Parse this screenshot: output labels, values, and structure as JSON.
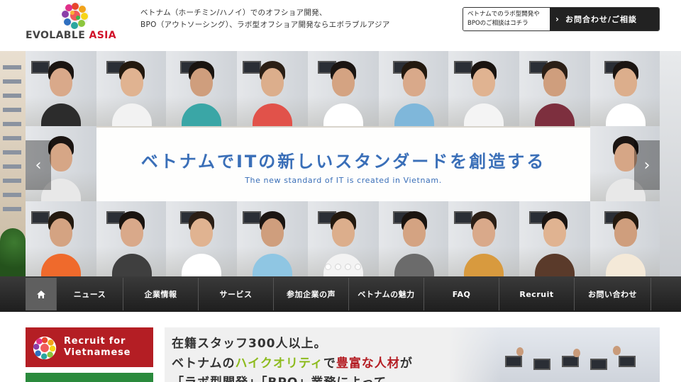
{
  "header": {
    "logo_word1": "EVOLABLE",
    "logo_word2": "ASIA",
    "tagline_line1": "ベトナム（ホーチミン/ハノイ）でのオフショア開発、",
    "tagline_line2": "BPO（アウトソーシング）、ラボ型オフショア開発ならエボラブルアジア",
    "consult_note_line1": "ベトナムでのラボ型開発や",
    "consult_note_line2": "BPOのご相談はコチラ",
    "consult_button": "お問合わせ/ご相談",
    "consult_arrow": "›"
  },
  "hero": {
    "title": "ベトナムでITの新しいスタンダードを創造する",
    "subtitle": "The new standard of IT is created in Vietnam.",
    "prev_arrow": "‹",
    "next_arrow": "›",
    "slide_count": 4,
    "active_slide": 1
  },
  "nav": {
    "items": [
      {
        "label": ""
      },
      {
        "label": "ニュース"
      },
      {
        "label": "企業情報"
      },
      {
        "label": "サービス"
      },
      {
        "label": "参加企業の声"
      },
      {
        "label": "ベトナムの魅力"
      },
      {
        "label": "FAQ"
      },
      {
        "label": "Recruit"
      },
      {
        "label": "お問い合わせ"
      }
    ]
  },
  "sidebar": {
    "recruit_line1": "Recruit for",
    "recruit_line2": "Vietnamese"
  },
  "feature": {
    "line1": "在籍スタッフ300人以上。",
    "line2_a": "ベトナムの",
    "line2_b": "ハイクオリティ",
    "line2_c": "で",
    "line2_d": "豊富な人材",
    "line2_e": "が",
    "line3": "「ラボ型開発」「BPO」業務によって"
  },
  "colors": {
    "brand_red": "#b41e24",
    "hero_blue": "#3a6fb8",
    "nav_dark": "#262626",
    "highlight_green": "#8dbb1e"
  }
}
